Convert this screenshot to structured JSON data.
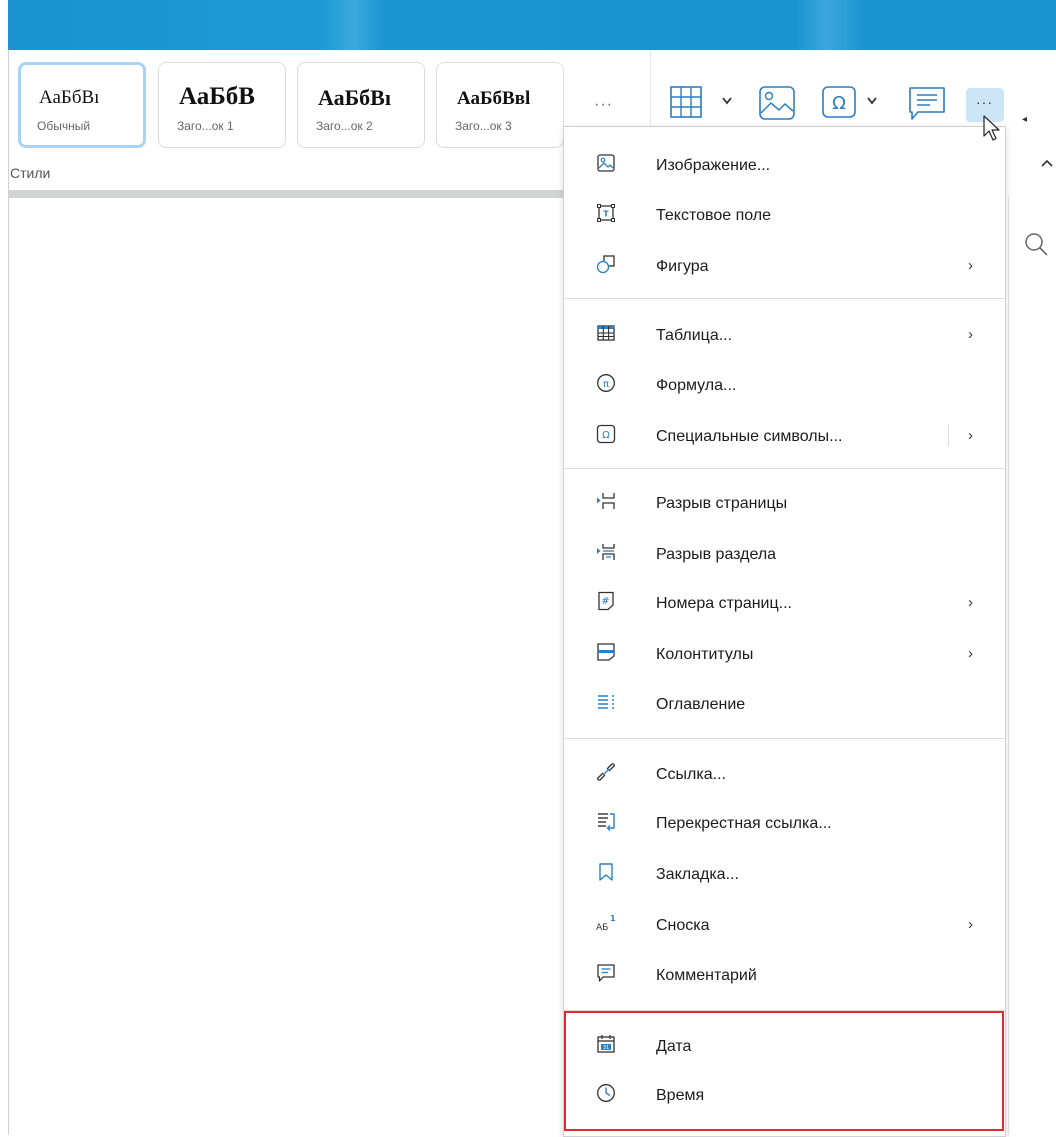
{
  "styles": {
    "label": "Стили",
    "more": "···",
    "cards": [
      {
        "sample": "АаБбВı",
        "name": "Обычный"
      },
      {
        "sample": "АаБбВ",
        "name": "Заго...ок 1"
      },
      {
        "sample": "АаБбВı",
        "name": "Заго...ок 2"
      },
      {
        "sample": "АаБбВвl",
        "name": "Заго...ок 3"
      }
    ]
  },
  "toolbar": {
    "more_button": "···",
    "icons": [
      "table-icon",
      "image-icon",
      "special-symbol-icon",
      "comment-icon",
      "more-icon"
    ]
  },
  "menu": {
    "items": [
      {
        "label": "Изображение...",
        "icon": "image-icon"
      },
      {
        "label": "Текстовое поле",
        "icon": "text-box-icon"
      },
      {
        "label": "Фигура",
        "icon": "shape-icon",
        "submenu": true
      },
      {
        "label": "Таблица...",
        "icon": "table-icon",
        "submenu": true
      },
      {
        "label": "Формула...",
        "icon": "formula-icon"
      },
      {
        "label": "Специальные символы...",
        "icon": "special-symbol-icon",
        "submenu": true
      },
      {
        "label": "Разрыв страницы",
        "icon": "page-break-icon"
      },
      {
        "label": "Разрыв раздела",
        "icon": "section-break-icon"
      },
      {
        "label": "Номера страниц...",
        "icon": "page-numbers-icon",
        "submenu": true
      },
      {
        "label": "Колонтитулы",
        "icon": "header-footer-icon",
        "submenu": true
      },
      {
        "label": "Оглавление",
        "icon": "toc-icon"
      },
      {
        "label": "Ссылка...",
        "icon": "link-icon"
      },
      {
        "label": "Перекрестная ссылка...",
        "icon": "cross-reference-icon"
      },
      {
        "label": "Закладка...",
        "icon": "bookmark-icon"
      },
      {
        "label": "Сноска",
        "icon": "footnote-icon",
        "submenu": true
      },
      {
        "label": "Комментарий",
        "icon": "comment-icon"
      },
      {
        "label": "Дата",
        "icon": "calendar-icon"
      },
      {
        "label": "Время",
        "icon": "clock-icon"
      }
    ],
    "submenu_arrow": "›",
    "footnote_icon_text": "АБ",
    "footnote_icon_sup": "1",
    "calendar_icon_text": "31"
  },
  "colors": {
    "accent": "#2c7fc2",
    "highlight_border": "#e02a34",
    "titlebar": "#1a93d0"
  }
}
